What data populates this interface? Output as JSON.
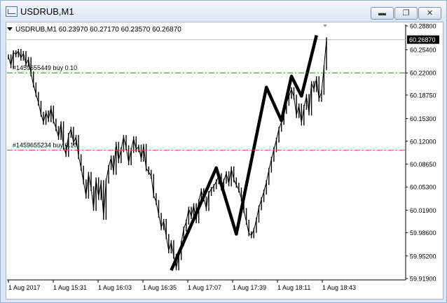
{
  "window": {
    "title": "USDRUB,M1",
    "buttons": {
      "minimize": "▬",
      "restore": "❐",
      "close": "✕"
    }
  },
  "chart_info": "USDRUB,M1  60.23970 60.27170 60.23570 60.26870",
  "price_tag": "60.26870",
  "orders": [
    {
      "label": "#1459655449 buy 0.10",
      "price": 60.22,
      "color": "#1f8a1f"
    },
    {
      "label": "#1459655234 buy 0.10",
      "price": 60.107,
      "color": "#e0562c"
    }
  ],
  "colors": {
    "accent": "#000000",
    "window_border": "#9aaed0",
    "price_tag_bg": "#000000"
  },
  "chart_data": {
    "type": "line",
    "symbol": "USDRUB",
    "timeframe": "M1",
    "ohlc_current": {
      "open": 60.2397,
      "high": 60.2717,
      "low": 60.2357,
      "close": 60.2687
    },
    "y_ticks": [
      60.2888,
      60.254,
      60.22,
      60.1875,
      60.153,
      60.12,
      60.0865,
      60.053,
      60.019,
      59.986,
      59.952,
      59.919
    ],
    "y_tick_labels": [
      "60.28800",
      "60.25400",
      "60.22000",
      "60.18750",
      "60.15300",
      "60.12000",
      "60.08650",
      "60.05300",
      "60.01900",
      "59.98600",
      "59.95200",
      "59.91900"
    ],
    "ylim": [
      59.919,
      60.2888
    ],
    "x_tick_labels": [
      "1 Aug 2017",
      "1 Aug 15:31",
      "1 Aug 16:03",
      "1 Aug 16:35",
      "1 Aug 17:07",
      "1 Aug 17:39",
      "1 Aug 18:11",
      "1 Aug 18:43"
    ],
    "series": [
      {
        "kind": "price",
        "values": [
          60.244,
          60.231,
          60.25,
          60.247,
          60.252,
          60.242,
          60.249,
          60.233,
          60.24,
          60.219,
          60.203,
          60.189,
          60.176,
          60.16,
          60.148,
          60.162,
          60.152,
          60.169,
          60.15,
          60.139,
          60.126,
          60.146,
          60.112,
          60.101,
          60.129,
          60.138,
          60.118,
          60.126,
          60.098,
          60.081,
          60.061,
          60.04,
          60.072,
          60.051,
          60.022,
          60.064,
          60.038,
          60.06,
          60.009,
          60.062,
          60.082,
          60.096,
          60.075,
          60.116,
          60.092,
          60.108,
          60.126,
          60.111,
          60.089,
          60.107,
          60.124,
          60.108,
          60.112,
          60.094,
          60.113,
          60.08,
          60.075,
          60.069,
          60.041,
          60.031,
          60.012,
          59.994,
          60.003,
          59.981,
          59.96,
          59.972,
          59.952,
          59.935,
          59.95,
          59.971,
          59.992,
          60.002,
          60.021,
          60.01,
          60.026,
          60.004,
          60.032,
          60.048,
          60.036,
          60.022,
          60.044,
          60.05,
          60.054,
          60.061,
          60.07,
          60.052,
          60.062,
          60.073,
          60.058,
          60.08,
          60.064,
          60.056,
          60.049,
          60.036,
          60.019,
          60.002,
          59.985,
          59.982,
          59.99,
          60.005,
          60.023,
          60.035,
          60.046,
          60.06,
          60.078,
          60.094,
          60.108,
          60.122,
          60.138,
          60.148,
          60.164,
          60.176,
          60.186,
          60.196,
          60.185,
          60.158,
          60.172,
          60.147,
          60.17,
          60.186,
          60.162,
          60.205,
          60.196,
          60.212,
          60.182,
          60.192,
          60.228,
          60.269
        ]
      },
      {
        "kind": "zigzag",
        "values": [
          59.931,
          60.081,
          59.984,
          60.199,
          60.15,
          60.215,
          60.186,
          60.275
        ]
      }
    ],
    "grid": false
  }
}
